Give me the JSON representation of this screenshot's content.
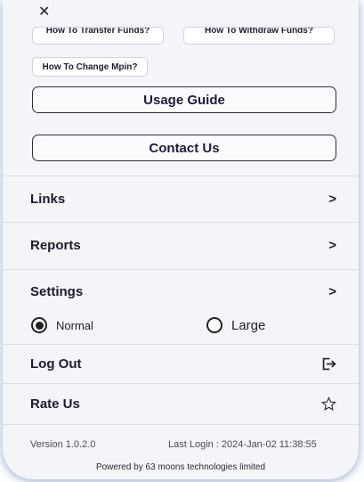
{
  "faq": {
    "transfer_label": "How To Transfer Funds?",
    "withdraw_label": "How To Withdraw Funds?",
    "mpin_label": "How To Change Mpin?"
  },
  "buttons": {
    "usage_guide": "Usage Guide",
    "contact_us": "Contact Us"
  },
  "menu": {
    "links": "Links",
    "reports": "Reports",
    "settings": "Settings",
    "log_out": "Log Out",
    "rate_us": "Rate Us",
    "chevron": ">"
  },
  "font_size_options": {
    "normal": "Normal",
    "large": "Large",
    "selected": "Normal"
  },
  "footer": {
    "version": "Version 1.0.2.0",
    "last_login": "Last Login : 2024-Jan-02 11:38:55",
    "powered_by": "Powered by 63 moons technologies limited"
  },
  "icons": {
    "close": "close-icon",
    "logout": "logout-icon",
    "star": "star-outline-icon"
  }
}
